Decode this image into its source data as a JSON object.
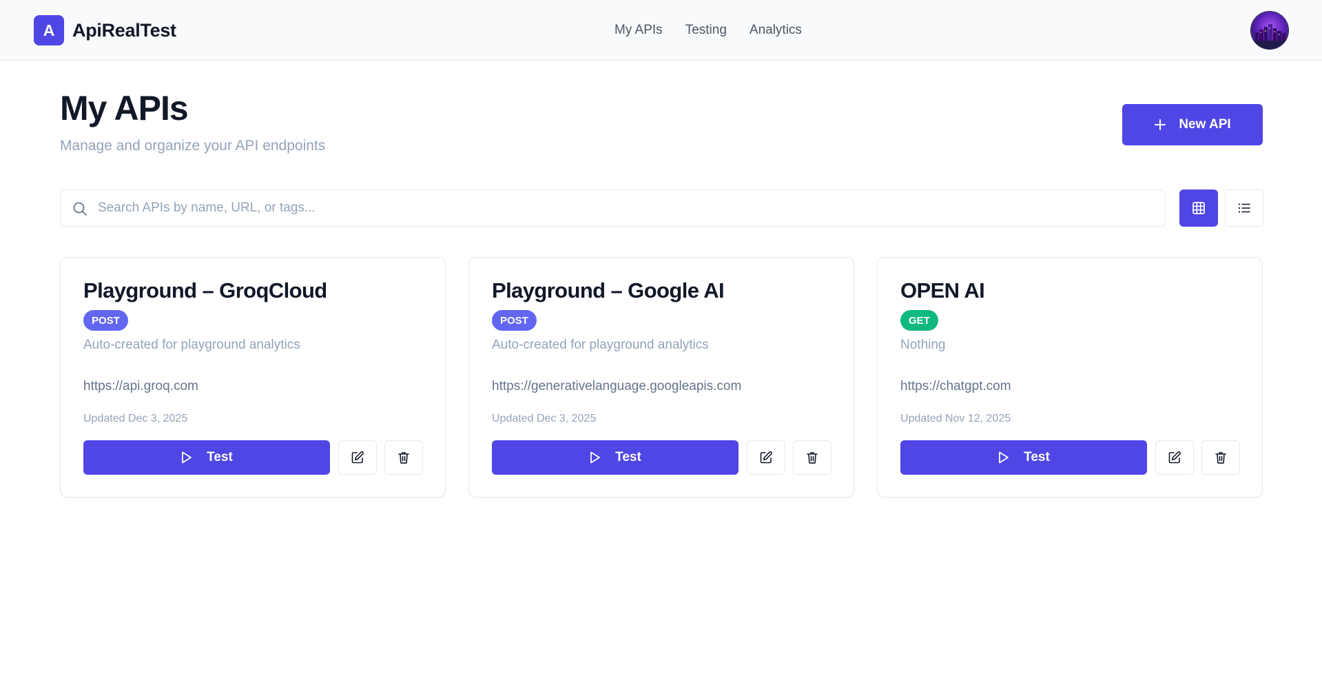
{
  "header": {
    "logo_letter": "A",
    "app_name": "ApiRealTest",
    "nav": [
      {
        "label": "My APIs"
      },
      {
        "label": "Testing"
      },
      {
        "label": "Analytics"
      }
    ]
  },
  "page": {
    "title": "My APIs",
    "subtitle": "Manage and organize your API endpoints",
    "new_button_label": "New API"
  },
  "search": {
    "placeholder": "Search APIs by name, URL, or tags...",
    "value": ""
  },
  "view_toggle": {
    "active": "grid"
  },
  "cards": [
    {
      "name": "Playground – GroqCloud",
      "method": "POST",
      "description": "Auto-created for playground analytics",
      "url": "https://api.groq.com",
      "updated": "Updated Dec 3, 2025",
      "test_label": "Test"
    },
    {
      "name": "Playground – Google AI",
      "method": "POST",
      "description": "Auto-created for playground analytics",
      "url": "https://generativelanguage.googleapis.com",
      "updated": "Updated Dec 3, 2025",
      "test_label": "Test"
    },
    {
      "name": "OPEN AI",
      "method": "GET",
      "description": "Nothing",
      "url": "https://chatgpt.com",
      "updated": "Updated Nov 12, 2025",
      "test_label": "Test"
    }
  ],
  "colors": {
    "accent": "#4f46e5",
    "post_badge": "#6366f1",
    "get_badge": "#10b981"
  }
}
